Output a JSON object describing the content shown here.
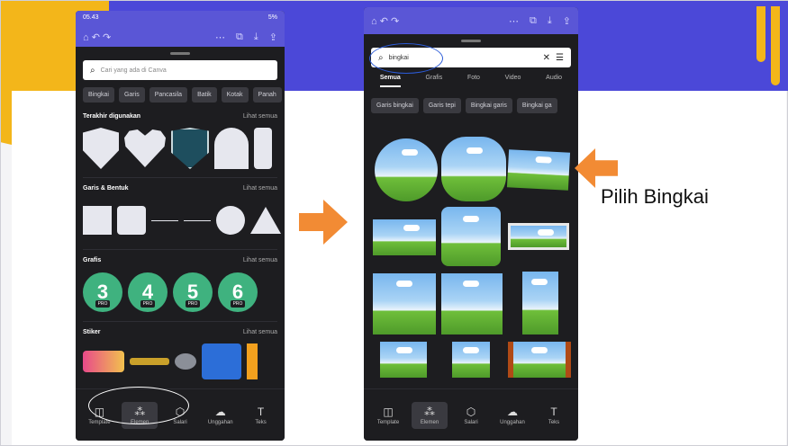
{
  "left_phone": {
    "status": {
      "time": "05.43",
      "right": "5%"
    },
    "search": {
      "placeholder": "Cari yang ada di Canva"
    },
    "chips": [
      "Bingkai",
      "Garis",
      "Pancasila",
      "Batik",
      "Kotak",
      "Panah"
    ],
    "sections": [
      {
        "title": "Terakhir digunakan",
        "link": "Lihat semua"
      },
      {
        "title": "Garis & Bentuk",
        "link": "Lihat semua"
      },
      {
        "title": "Grafis",
        "link": "Lihat semua"
      },
      {
        "title": "Stiker",
        "link": "Lihat semua"
      }
    ],
    "grafis_numbers": [
      "3",
      "4",
      "5",
      "6"
    ],
    "pro_badge": "PRO",
    "nav": [
      {
        "icon": "template-icon",
        "label": "Template"
      },
      {
        "icon": "elements-icon",
        "label": "Elemen"
      },
      {
        "icon": "upload-icon",
        "label": "Salari"
      },
      {
        "icon": "cloud-upload-icon",
        "label": "Unggahan"
      },
      {
        "icon": "text-icon",
        "label": "Teks"
      }
    ],
    "active_nav": "Elemen"
  },
  "right_phone": {
    "search": {
      "value": "bingkai"
    },
    "tabs": [
      "Semua",
      "Grafis",
      "Foto",
      "Video",
      "Audio"
    ],
    "active_tab": "Semua",
    "chips": [
      "Garis bingkai",
      "Garis tepi",
      "Bingkai garis",
      "Bingkai ga"
    ],
    "nav": [
      {
        "icon": "template-icon",
        "label": "Template"
      },
      {
        "icon": "elements-icon",
        "label": "Elemen"
      },
      {
        "icon": "upload-icon",
        "label": "Salari"
      },
      {
        "icon": "cloud-upload-icon",
        "label": "Unggahan"
      },
      {
        "icon": "text-icon",
        "label": "Teks"
      }
    ]
  },
  "caption": "Pilih Bingkai",
  "colors": {
    "purple": "#4b48d8",
    "yellow": "#f3b61a",
    "orange": "#f28b34",
    "graf_green": "#3fb27f"
  }
}
